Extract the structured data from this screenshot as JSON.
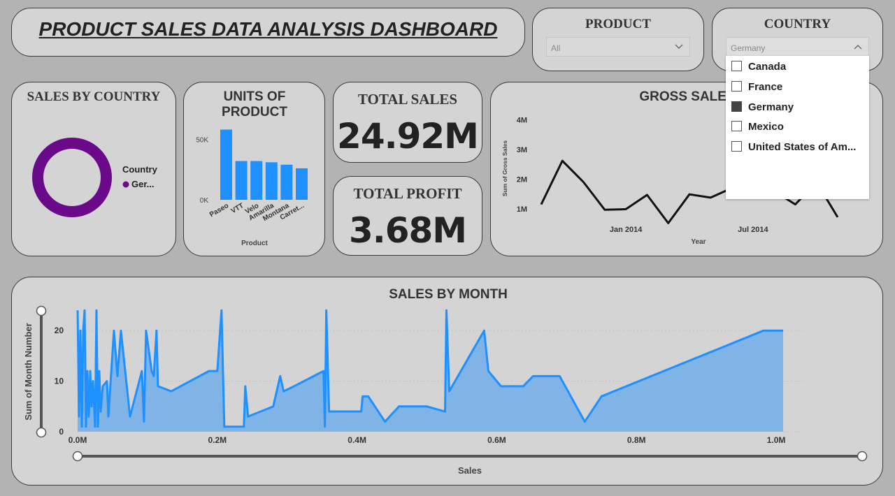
{
  "header": {
    "title": "PRODUCT SALES DATA ANALYSIS  DASHBOARD"
  },
  "product_slicer": {
    "title": "PRODUCT",
    "value": "All"
  },
  "country_slicer": {
    "title": "COUNTRY",
    "value": "Germany",
    "options": [
      {
        "label": "Canada",
        "checked": false
      },
      {
        "label": "France",
        "checked": false
      },
      {
        "label": "Germany",
        "checked": true
      },
      {
        "label": "Mexico",
        "checked": false
      },
      {
        "label": "United States of Am...",
        "checked": false
      }
    ]
  },
  "kpis": {
    "total_sales": {
      "title": "TOTAL SALES",
      "value": "24.92M"
    },
    "total_profit": {
      "title": "TOTAL PROFIT",
      "value": "3.68M"
    }
  },
  "colors": {
    "donut": "#6a0a8a",
    "bars": "#1e90ff",
    "line": "#111111",
    "area_line": "#1e90ff",
    "area_fill": "#80b4e6"
  },
  "chart_data": [
    {
      "id": "sales_by_country",
      "type": "pie",
      "title": "SALES BY COUNTRY",
      "legend_title": "Country",
      "labels": [
        "Ger..."
      ],
      "values": [
        100
      ]
    },
    {
      "id": "units_of_product",
      "type": "bar",
      "title": "UNITS OF PRODUCT",
      "xlabel": "Product",
      "categories": [
        "Paseo",
        "VTT",
        "Velo",
        "Amarilla",
        "Montana",
        "Carret..."
      ],
      "values": [
        58000,
        32000,
        32000,
        31000,
        29000,
        26000
      ],
      "yticks": [
        {
          "value": 0,
          "label": "0K"
        },
        {
          "value": 50000,
          "label": "50K"
        }
      ],
      "ylim": [
        0,
        60000
      ]
    },
    {
      "id": "gross_sales",
      "type": "line",
      "title": "GROSS SALES",
      "xlabel": "Year",
      "ylabel": "Sum of Gross Sales",
      "ylim": [
        0.6,
        4.2
      ],
      "yticks": [
        {
          "value": 1,
          "label": "1M"
        },
        {
          "value": 2,
          "label": "2M"
        },
        {
          "value": 3,
          "label": "3M"
        },
        {
          "value": 4,
          "label": "4M"
        }
      ],
      "xticks": [
        {
          "value": 4,
          "label": "Jan 2014"
        },
        {
          "value": 10,
          "label": "Jul 2014"
        }
      ],
      "x": [
        0,
        1,
        2,
        3,
        4,
        5,
        6,
        7,
        8,
        9,
        10,
        11,
        12,
        13,
        14
      ],
      "values": [
        1.15,
        2.62,
        1.9,
        0.97,
        0.99,
        1.47,
        0.52,
        1.49,
        1.38,
        1.7,
        2.1,
        1.6,
        1.15,
        1.9,
        0.72
      ]
    },
    {
      "id": "sales_by_month",
      "type": "area",
      "title": "SALES BY MONTH",
      "xlabel": "Sales",
      "ylabel": "Sum of Month Number",
      "xlim": [
        0,
        1.04
      ],
      "ylim": [
        0,
        25
      ],
      "xticks": [
        {
          "value": 0,
          "label": "0.0M"
        },
        {
          "value": 0.2,
          "label": "0.2M"
        },
        {
          "value": 0.4,
          "label": "0.4M"
        },
        {
          "value": 0.6,
          "label": "0.6M"
        },
        {
          "value": 0.8,
          "label": "0.8M"
        },
        {
          "value": 1.0,
          "label": "1.0M"
        }
      ],
      "yticks": [
        {
          "value": 0,
          "label": "0"
        },
        {
          "value": 10,
          "label": "10"
        },
        {
          "value": 20,
          "label": "20"
        }
      ],
      "points": [
        [
          0.0,
          24
        ],
        [
          0.002,
          3
        ],
        [
          0.004,
          20
        ],
        [
          0.006,
          1
        ],
        [
          0.008,
          20
        ],
        [
          0.01,
          24
        ],
        [
          0.012,
          1
        ],
        [
          0.014,
          12
        ],
        [
          0.016,
          3
        ],
        [
          0.018,
          12
        ],
        [
          0.02,
          5
        ],
        [
          0.022,
          10
        ],
        [
          0.025,
          1
        ],
        [
          0.027,
          24
        ],
        [
          0.029,
          1
        ],
        [
          0.031,
          12
        ],
        [
          0.033,
          4
        ],
        [
          0.036,
          9
        ],
        [
          0.042,
          10
        ],
        [
          0.044,
          3
        ],
        [
          0.052,
          20
        ],
        [
          0.057,
          11
        ],
        [
          0.062,
          20
        ],
        [
          0.075,
          3
        ],
        [
          0.092,
          12
        ],
        [
          0.095,
          2
        ],
        [
          0.098,
          20
        ],
        [
          0.106,
          12
        ],
        [
          0.109,
          11
        ],
        [
          0.113,
          20
        ],
        [
          0.115,
          9
        ],
        [
          0.134,
          8
        ],
        [
          0.188,
          12
        ],
        [
          0.2,
          12
        ],
        [
          0.206,
          24
        ],
        [
          0.21,
          1
        ],
        [
          0.238,
          1
        ],
        [
          0.24,
          9
        ],
        [
          0.244,
          3
        ],
        [
          0.28,
          5
        ],
        [
          0.29,
          11
        ],
        [
          0.295,
          8
        ],
        [
          0.31,
          9
        ],
        [
          0.352,
          12
        ],
        [
          0.354,
          1
        ],
        [
          0.356,
          24
        ],
        [
          0.36,
          4
        ],
        [
          0.406,
          4
        ],
        [
          0.408,
          7
        ],
        [
          0.416,
          7
        ],
        [
          0.44,
          2
        ],
        [
          0.46,
          5
        ],
        [
          0.5,
          5
        ],
        [
          0.526,
          4
        ],
        [
          0.528,
          24
        ],
        [
          0.532,
          8
        ],
        [
          0.582,
          20
        ],
        [
          0.588,
          12
        ],
        [
          0.606,
          9
        ],
        [
          0.638,
          9
        ],
        [
          0.652,
          11
        ],
        [
          0.69,
          11
        ],
        [
          0.726,
          2
        ],
        [
          0.75,
          7
        ],
        [
          0.982,
          20
        ],
        [
          1.01,
          20
        ]
      ]
    }
  ]
}
